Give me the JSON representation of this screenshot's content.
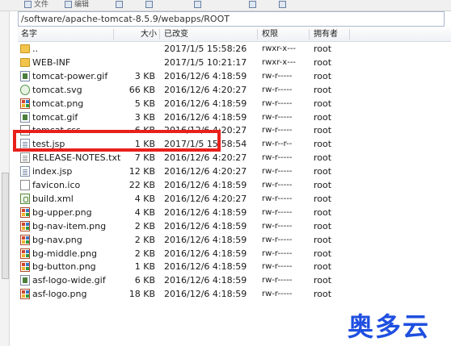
{
  "toolbar": {
    "items": [
      "文件",
      "编辑"
    ]
  },
  "path": "/software/apache-tomcat-8.5.9/webapps/ROOT",
  "columns": {
    "name": "名字",
    "size": "大小",
    "modified": "已改变",
    "permissions": "权限",
    "owner": "拥有者"
  },
  "files": [
    {
      "name": "..",
      "size": "",
      "modified": "2017/1/5 15:58:26",
      "permissions": "rwxr-x---",
      "owner": "root",
      "icon": "folder-up-icon"
    },
    {
      "name": "WEB-INF",
      "size": "",
      "modified": "2017/1/5 10:21:17",
      "permissions": "rwxr-x---",
      "owner": "root",
      "icon": "folder-icon"
    },
    {
      "name": "tomcat-power.gif",
      "size": "3 KB",
      "modified": "2016/12/6 4:18:59",
      "permissions": "rw-r-----",
      "owner": "root",
      "icon": "gif-image-icon"
    },
    {
      "name": "tomcat.svg",
      "size": "66 KB",
      "modified": "2016/12/6 4:20:27",
      "permissions": "rw-r-----",
      "owner": "root",
      "icon": "svg-file-icon"
    },
    {
      "name": "tomcat.png",
      "size": "5 KB",
      "modified": "2016/12/6 4:18:59",
      "permissions": "rw-r-----",
      "owner": "root",
      "icon": "png-image-icon"
    },
    {
      "name": "tomcat.gif",
      "size": "3 KB",
      "modified": "2016/12/6 4:18:59",
      "permissions": "rw-r-----",
      "owner": "root",
      "icon": "gif-image-icon"
    },
    {
      "name": "tomcat.css",
      "size": "6 KB",
      "modified": "2016/12/6 4:20:27",
      "permissions": "rw-r-----",
      "owner": "root",
      "icon": "css-file-icon"
    },
    {
      "name": "test.jsp",
      "size": "1 KB",
      "modified": "2017/1/5 15:58:54",
      "permissions": "rw-r--r--",
      "owner": "root",
      "icon": "jsp-file-icon"
    },
    {
      "name": "RELEASE-NOTES.txt",
      "size": "7 KB",
      "modified": "2016/12/6 4:20:27",
      "permissions": "rw-r-----",
      "owner": "root",
      "icon": "text-file-icon"
    },
    {
      "name": "index.jsp",
      "size": "12 KB",
      "modified": "2016/12/6 4:20:27",
      "permissions": "rw-r-----",
      "owner": "root",
      "icon": "jsp-file-icon"
    },
    {
      "name": "favicon.ico",
      "size": "22 KB",
      "modified": "2016/12/6 4:18:59",
      "permissions": "rw-r-----",
      "owner": "root",
      "icon": "ico-file-icon"
    },
    {
      "name": "build.xml",
      "size": "4 KB",
      "modified": "2016/12/6 4:20:27",
      "permissions": "rw-r-----",
      "owner": "root",
      "icon": "xml-file-icon"
    },
    {
      "name": "bg-upper.png",
      "size": "4 KB",
      "modified": "2016/12/6 4:18:59",
      "permissions": "rw-r-----",
      "owner": "root",
      "icon": "png-image-icon"
    },
    {
      "name": "bg-nav-item.png",
      "size": "2 KB",
      "modified": "2016/12/6 4:18:59",
      "permissions": "rw-r-----",
      "owner": "root",
      "icon": "png-image-icon"
    },
    {
      "name": "bg-nav.png",
      "size": "2 KB",
      "modified": "2016/12/6 4:18:59",
      "permissions": "rw-r-----",
      "owner": "root",
      "icon": "png-image-icon"
    },
    {
      "name": "bg-middle.png",
      "size": "2 KB",
      "modified": "2016/12/6 4:18:59",
      "permissions": "rw-r-----",
      "owner": "root",
      "icon": "png-image-icon"
    },
    {
      "name": "bg-button.png",
      "size": "1 KB",
      "modified": "2016/12/6 4:18:59",
      "permissions": "rw-r-----",
      "owner": "root",
      "icon": "png-image-icon"
    },
    {
      "name": "asf-logo-wide.gif",
      "size": "6 KB",
      "modified": "2016/12/6 4:18:59",
      "permissions": "rw-r-----",
      "owner": "root",
      "icon": "gif-image-icon"
    },
    {
      "name": "asf-logo.png",
      "size": "18 KB",
      "modified": "2016/12/6 4:18:59",
      "permissions": "rw-r-----",
      "owner": "root",
      "icon": "png-image-icon"
    }
  ],
  "highlight_color": "#e8201c",
  "watermark": "奥多云"
}
